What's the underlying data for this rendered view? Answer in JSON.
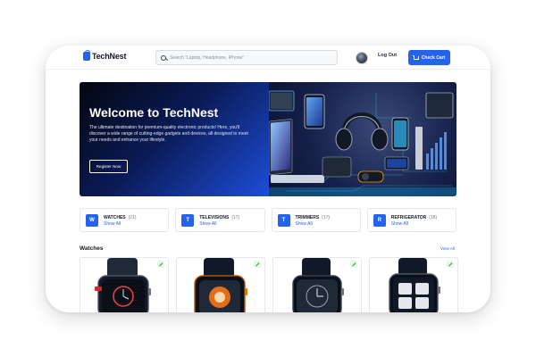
{
  "header": {
    "logo_text": "TechNest",
    "search_placeholder": "Search \"Laptop, Headphone, iPhone\"",
    "logout_label": "Log Out",
    "cart_label": "Check Cart"
  },
  "hero": {
    "title": "Welcome to TechNest",
    "description": "The ultimate destination for premium-quality electronic products! Here, you'll discover a wide range of cutting-edge gadgets and devices, all designed to meet your needs and enhance your lifestyle.",
    "button_label": "Register Now"
  },
  "categories": [
    {
      "badge": "W",
      "name": "WATCHES",
      "count": "(21)",
      "link": "Show All"
    },
    {
      "badge": "T",
      "name": "TELEVISIONS",
      "count": "(17)",
      "link": "Show All"
    },
    {
      "badge": "T",
      "name": "TRIMMERS",
      "count": "(17)",
      "link": "Show All"
    },
    {
      "badge": "R",
      "name": "REFRIGERATOR",
      "count": "(16)",
      "link": "Show All"
    }
  ],
  "section": {
    "title": "Watches",
    "view_all": "View All"
  },
  "colors": {
    "accent": "#2563eb",
    "edit_green": "#16a34a"
  },
  "icons": [
    "logo-icon",
    "search-icon",
    "cart-icon",
    "edit-icon"
  ]
}
